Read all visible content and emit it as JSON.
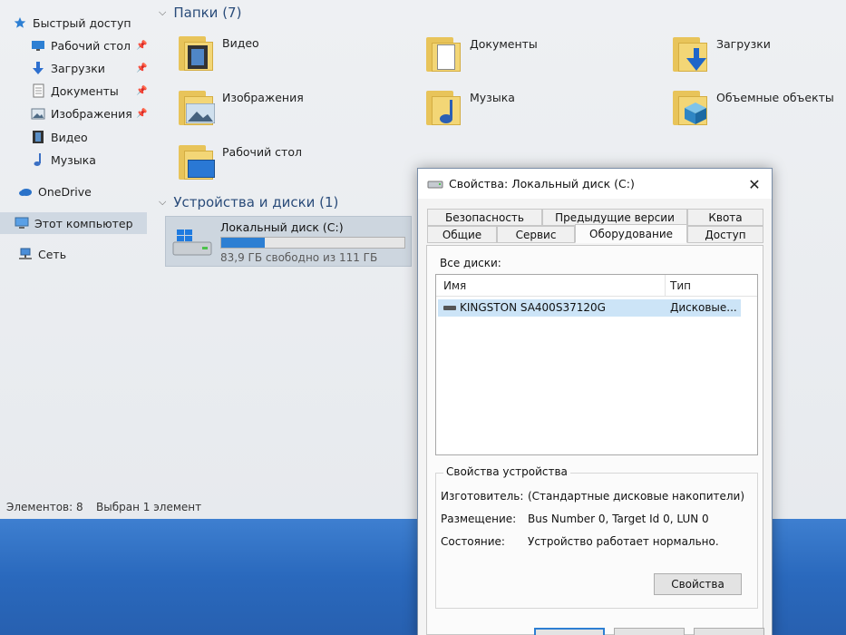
{
  "nav": {
    "quick_access": "Быстрый доступ",
    "items": [
      {
        "label": "Рабочий стол",
        "pinned": true
      },
      {
        "label": "Загрузки",
        "pinned": true
      },
      {
        "label": "Документы",
        "pinned": true
      },
      {
        "label": "Изображения",
        "pinned": true
      },
      {
        "label": "Видео",
        "pinned": false
      },
      {
        "label": "Музыка",
        "pinned": false
      }
    ],
    "onedrive": "OneDrive",
    "this_pc": "Этот компьютер",
    "network": "Сеть"
  },
  "main": {
    "folders_header": "Папки (7)",
    "folders": [
      "Видео",
      "Документы",
      "Загрузки",
      "Изображения",
      "Музыка",
      "Объемные объекты",
      "Рабочий стол"
    ],
    "devices_header": "Устройства и диски (1)",
    "drive": {
      "name": "Локальный диск (C:)",
      "free_text": "83,9 ГБ свободно из 111 ГБ",
      "used_fraction": 0.24
    }
  },
  "status": {
    "items": "Элементов: 8",
    "selected": "Выбран 1 элемент"
  },
  "dialog": {
    "title": "Свойства: Локальный диск (C:)",
    "tabs_row1": [
      "Безопасность",
      "Предыдущие версии",
      "Квота"
    ],
    "tabs_row2": [
      "Общие",
      "Сервис",
      "Оборудование",
      "Доступ"
    ],
    "active_tab": "Оборудование",
    "all_disks_label": "Все диски:",
    "columns": [
      "Имя",
      "Тип"
    ],
    "rows": [
      {
        "name": "KINGSTON SA400S37120G",
        "type": "Дисковые..."
      }
    ],
    "device_props_title": "Свойства устройства",
    "props": [
      {
        "label": "Изготовитель:",
        "value": "(Стандартные дисковые накопители)"
      },
      {
        "label": "Размещение:",
        "value": "Bus Number 0, Target Id 0, LUN 0"
      },
      {
        "label": "Состояние:",
        "value": "Устройство работает нормально."
      }
    ],
    "properties_button": "Свойства"
  },
  "colors": {
    "accent": "#2d7fd3",
    "folder": "#f3d676",
    "selection": "#cce4f7",
    "desktop": "#2a69bd"
  }
}
